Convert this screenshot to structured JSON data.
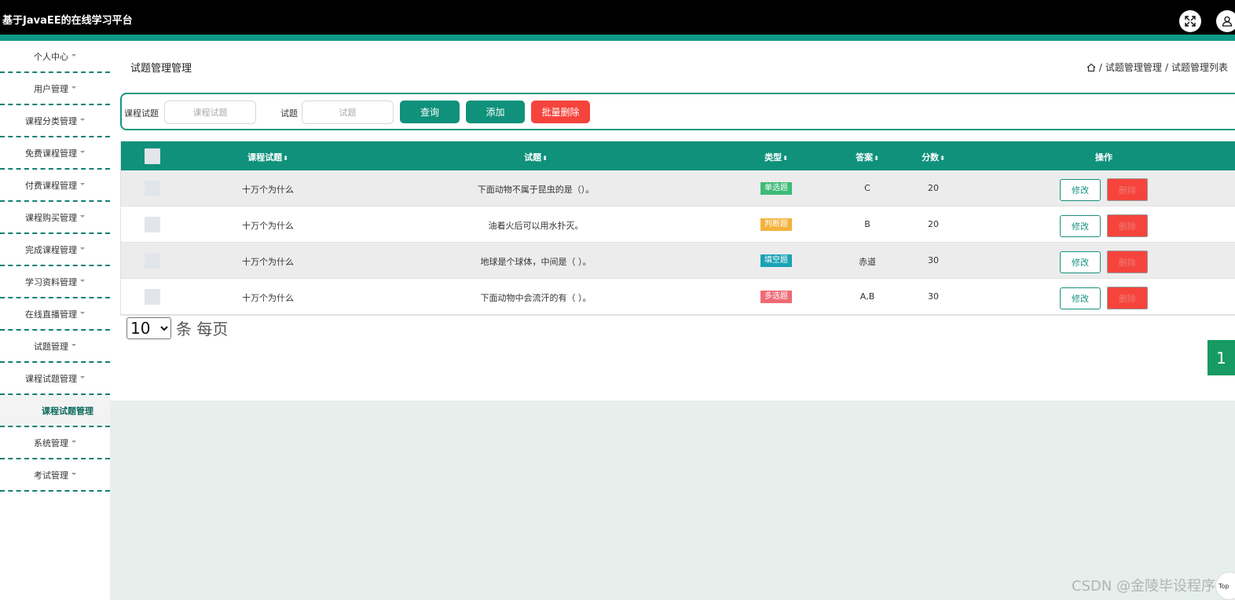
{
  "header": {
    "title": "基于JavaEE的在线学习平台",
    "fullscreen_icon": "expand-icon",
    "user_icon": "user-icon",
    "accent_color": "#0f9a85"
  },
  "sidebar": {
    "items": [
      {
        "label": "个人中心"
      },
      {
        "label": "用户管理"
      },
      {
        "label": "课程分类管理"
      },
      {
        "label": "免费课程管理"
      },
      {
        "label": "付费课程管理"
      },
      {
        "label": "课程购买管理"
      },
      {
        "label": "完成课程管理"
      },
      {
        "label": "学习资料管理"
      },
      {
        "label": "在线直播管理"
      },
      {
        "label": "试题管理"
      },
      {
        "label": "课程试题管理"
      },
      {
        "label": "课程试题管理"
      },
      {
        "label": "系统管理"
      },
      {
        "label": "考试管理"
      }
    ]
  },
  "page": {
    "title": "试题管理管理",
    "breadcrumb": [
      "试题管理管理",
      "试题管理列表"
    ]
  },
  "search": {
    "label1": "课程试题",
    "placeholder1": "课程试题",
    "label2": "试题",
    "placeholder2": "试题",
    "query_label": "查询",
    "add_label": "添加",
    "batch_delete_label": "批量删除"
  },
  "table": {
    "headers": {
      "course": "课程试题",
      "question": "试题",
      "type": "类型",
      "answer": "答案",
      "score": "分数",
      "actions": "操作"
    },
    "rows": [
      {
        "course": "十万个为什么",
        "question": "下面动物不属于昆虫的是（）。",
        "type": "单选题",
        "type_color": "#3dbb77",
        "answer": "C",
        "score": "20",
        "edit": "修改",
        "delete": "删除"
      },
      {
        "course": "十万个为什么",
        "question": "油着火后可以用水扑灭。",
        "type": "判断题",
        "type_color": "#f4b23a",
        "answer": "B",
        "score": "20",
        "edit": "修改",
        "delete": "删除"
      },
      {
        "course": "十万个为什么",
        "question": "地球是个球体，中间是（ ）。",
        "type": "填空题",
        "type_color": "#1aa2b5",
        "answer": "赤道",
        "score": "30",
        "edit": "修改",
        "delete": "删除"
      },
      {
        "course": "十万个为什么",
        "question": "下面动物中会流汗的有（ ）。",
        "type": "多选题",
        "type_color": "#ef6a74",
        "answer": "A,B",
        "score": "30",
        "edit": "修改",
        "delete": "删除"
      }
    ]
  },
  "pagination": {
    "page_size": "10",
    "per_page_text": "条 每页",
    "current_page": "1"
  },
  "watermark": "CSDN @金陵毕设程序",
  "top_button": "Top"
}
